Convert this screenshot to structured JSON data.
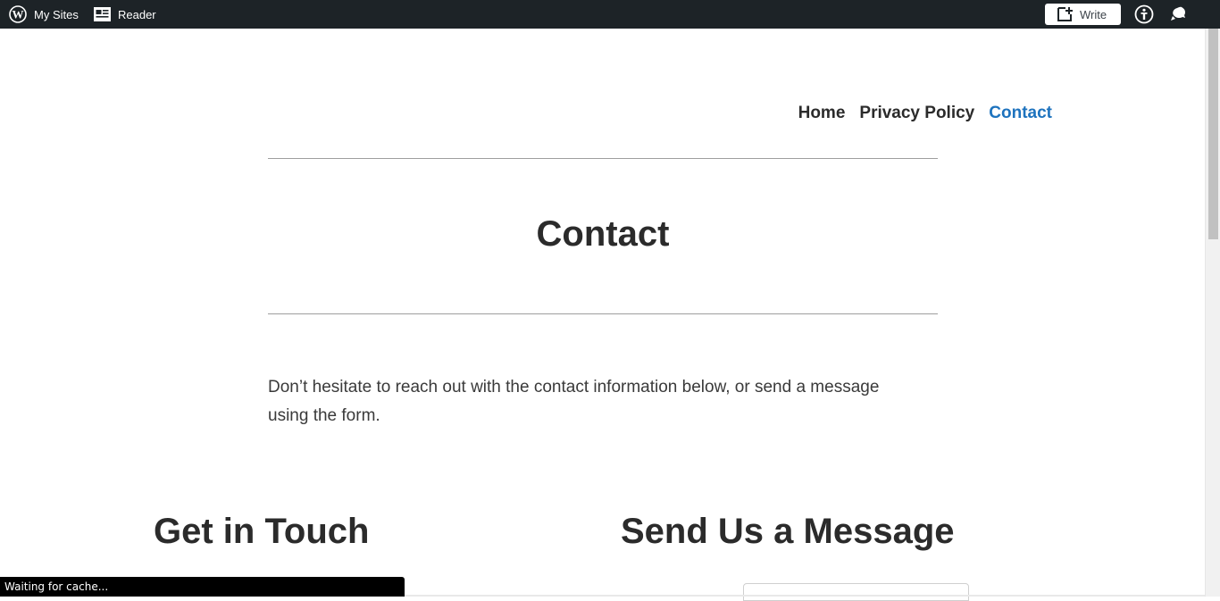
{
  "admin_bar": {
    "my_sites": "My Sites",
    "reader": "Reader",
    "write": "Write"
  },
  "nav": {
    "items": [
      {
        "label": "Home"
      },
      {
        "label": "Privacy Policy"
      },
      {
        "label": "Contact",
        "current": true
      }
    ]
  },
  "page": {
    "title": "Contact",
    "intro": "Don’t hesitate to reach out with the contact information below, or send a message using the form.",
    "sections": {
      "left_heading": "Get in Touch",
      "right_heading": "Send Us a Message"
    }
  },
  "status": {
    "text": "Waiting for cache..."
  },
  "icons": {
    "wordpress": "wordpress-icon",
    "reader": "reader-icon",
    "write": "new-post-icon",
    "help": "help-icon",
    "notifications": "notifications-icon"
  },
  "colors": {
    "admin_bar": "#1d2327",
    "nav_current": "#1e73be",
    "text": "#2b2b2b"
  }
}
